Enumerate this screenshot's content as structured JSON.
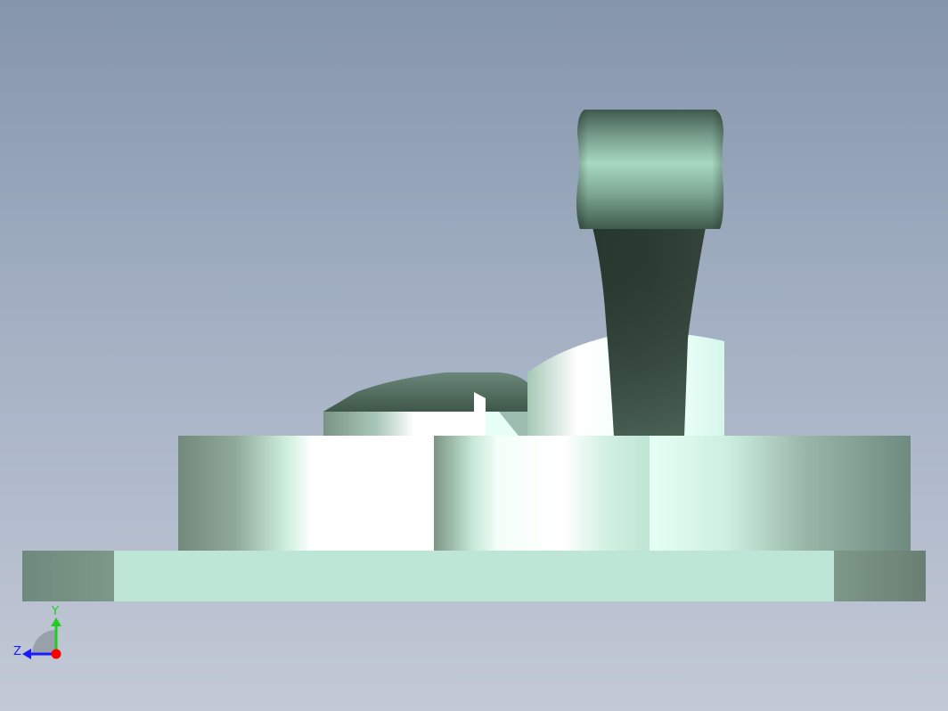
{
  "viewport": {
    "name": "3D model view",
    "background_top": "#8595ac",
    "background_bottom": "#c3c9d6"
  },
  "model": {
    "base_color": "#bde6d6",
    "shadow_color": "#6f8a7c",
    "dark_color": "#34463a",
    "highlight_color": "#ffffff"
  },
  "triad": {
    "y_label": "Y",
    "z_label": "Z",
    "x_color": "#ff0000",
    "y_color": "#22cc22",
    "z_color": "#1a1aff"
  }
}
